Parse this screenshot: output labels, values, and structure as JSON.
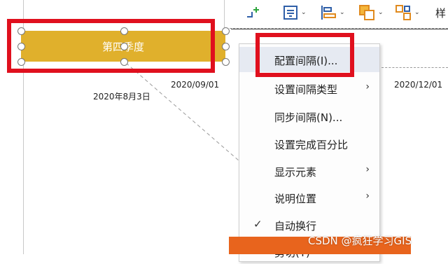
{
  "interval": {
    "label": "第四季度"
  },
  "timeline": {
    "date_label": "2020年8月3日",
    "ticks": [
      "2020/09/01",
      "2020/12/01"
    ]
  },
  "toolbar": {
    "trailing_text": "样"
  },
  "context_menu": {
    "items": [
      {
        "label": "配置间隔(I)...",
        "highlighted": true,
        "submenu": false,
        "checked": false
      },
      {
        "label": "设置间隔类型",
        "highlighted": false,
        "submenu": true,
        "checked": false
      },
      {
        "label": "同步间隔(N)...",
        "highlighted": false,
        "submenu": false,
        "checked": false
      },
      {
        "label": "设置完成百分比",
        "highlighted": false,
        "submenu": false,
        "checked": false
      },
      {
        "label": "显示元素",
        "highlighted": false,
        "submenu": true,
        "checked": false
      },
      {
        "label": "说明位置",
        "highlighted": false,
        "submenu": true,
        "checked": false
      },
      {
        "label": "自动换行",
        "highlighted": false,
        "submenu": false,
        "checked": true
      },
      {
        "label": "剪切(T)",
        "highlighted": false,
        "submenu": false,
        "checked": false
      }
    ]
  },
  "watermark": "CSDN @疯狂学习GIS",
  "colors": {
    "bar": "#e0b02c",
    "highlight_box": "#e0101e",
    "menu_highlight": "#e6eaf2"
  }
}
